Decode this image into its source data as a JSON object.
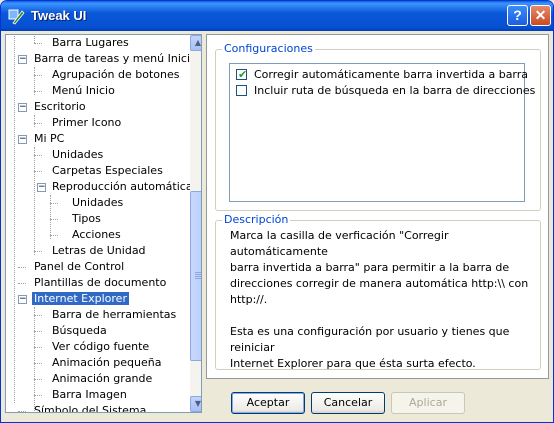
{
  "window": {
    "title": "Tweak UI"
  },
  "titlebar": {
    "help_label": "?",
    "close_label": "✕"
  },
  "tree": {
    "items": [
      {
        "label": "Barra Lugares",
        "selected": false
      },
      {
        "label": "Barra de tareas y menú Inicio",
        "selected": false,
        "expander": "−"
      },
      {
        "label": "Agrupación de botones",
        "selected": false
      },
      {
        "label": "Menú Inicio",
        "selected": false
      },
      {
        "label": "Escritorio",
        "selected": false,
        "expander": "−"
      },
      {
        "label": "Primer Icono",
        "selected": false
      },
      {
        "label": "Mi PC",
        "selected": false,
        "expander": "−"
      },
      {
        "label": "Unidades",
        "selected": false
      },
      {
        "label": "Carpetas Especiales",
        "selected": false
      },
      {
        "label": "Reproducción automática",
        "selected": false,
        "expander": "−"
      },
      {
        "label": "Unidades",
        "selected": false
      },
      {
        "label": "Tipos",
        "selected": false
      },
      {
        "label": "Acciones",
        "selected": false
      },
      {
        "label": "Letras de Unidad",
        "selected": false
      },
      {
        "label": "Panel de Control",
        "selected": false
      },
      {
        "label": "Plantillas de documento",
        "selected": false
      },
      {
        "label": "Internet Explorer",
        "selected": true,
        "expander": "−"
      },
      {
        "label": "Barra de herramientas",
        "selected": false
      },
      {
        "label": "Búsqueda",
        "selected": false
      },
      {
        "label": "Ver código fuente",
        "selected": false
      },
      {
        "label": "Animación pequeña",
        "selected": false
      },
      {
        "label": "Animación grande",
        "selected": false
      },
      {
        "label": "Barra Imagen",
        "selected": false
      },
      {
        "label": "Símbolo del Sistema",
        "selected": false
      }
    ],
    "scroll_up": "▲",
    "scroll_down": "▼"
  },
  "configuraciones": {
    "title": "Configuraciones",
    "options": [
      {
        "label": "Corregir automáticamente barra invertida a barra",
        "checked": true
      },
      {
        "label": "Incluir ruta de búsqueda en la barra de direcciones",
        "checked": false
      }
    ],
    "check_glyph": "✔"
  },
  "descripcion": {
    "title": "Descripción",
    "text": "Marca la casilla de verficación \"Corregir automáticamente\nbarra invertida a barra\" para permitir a la barra de\ndirecciones corregir de manera automática http:\\\\ con\nhttp://.\n\nEsta es una configuración por usuario y tienes que reiniciar\nInternet Explorer para que ésta surta efecto."
  },
  "buttons": {
    "accept": "Aceptar",
    "cancel": "Cancelar",
    "apply": "Aplicar"
  }
}
